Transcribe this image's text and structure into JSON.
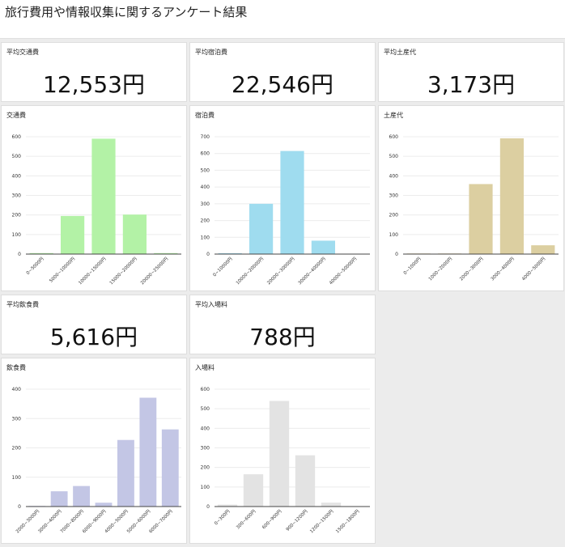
{
  "header": {
    "title": "旅行費用や情報収集に関するアンケート結果"
  },
  "kpis": {
    "transport": {
      "label": "平均交通費",
      "value": "12,553円"
    },
    "lodging": {
      "label": "平均宿泊費",
      "value": "22,546円"
    },
    "souvenir": {
      "label": "平均土産代",
      "value": "3,173円"
    },
    "food": {
      "label": "平均飲食費",
      "value": "5,616円"
    },
    "admission": {
      "label": "平均入場料",
      "value": "788円"
    }
  },
  "chart_data": [
    {
      "id": "transport",
      "type": "bar",
      "title": "交通費",
      "categories": [
        "0~5000円",
        "5000~10000円",
        "10000~15000円",
        "15000~20000円",
        "20000~25000円"
      ],
      "values": [
        5,
        195,
        590,
        202,
        5
      ],
      "ylim": [
        0,
        600
      ],
      "yticks": [
        0,
        100,
        200,
        300,
        400,
        500,
        600
      ],
      "color": "#b3f2a6",
      "grid": true
    },
    {
      "id": "lodging",
      "type": "bar",
      "title": "宿泊費",
      "categories": [
        "0~10000円",
        "10000~20000円",
        "20000~30000円",
        "30000~40000円",
        "40000~50000円"
      ],
      "values": [
        5,
        300,
        615,
        80,
        2
      ],
      "ylim": [
        0,
        700
      ],
      "yticks": [
        0,
        100,
        200,
        300,
        400,
        500,
        600,
        700
      ],
      "color": "#9fdcef",
      "grid": true
    },
    {
      "id": "souvenir",
      "type": "bar",
      "title": "土産代",
      "categories": [
        "0~1000円",
        "1000~2000円",
        "2000~3000円",
        "3000~4000円",
        "4000~5000円"
      ],
      "values": [
        3,
        3,
        358,
        592,
        45
      ],
      "ylim": [
        0,
        600
      ],
      "yticks": [
        0,
        100,
        200,
        300,
        400,
        500,
        600
      ],
      "color": "#dccfa1",
      "grid": true
    },
    {
      "id": "food",
      "type": "bar",
      "title": "飲食費",
      "categories": [
        "2000~3000円",
        "3000~4000円",
        "7000~8000円",
        "6000~9000円",
        "4000~5000円",
        "5000~6000円",
        "6000~7000円"
      ],
      "values": [
        2,
        52,
        70,
        13,
        227,
        371,
        263
      ],
      "ylim": [
        0,
        400
      ],
      "yticks": [
        0,
        100,
        200,
        300,
        400
      ],
      "color": "#c3c6e5",
      "grid": true
    },
    {
      "id": "admission",
      "type": "bar",
      "title": "入場料",
      "categories": [
        "0~300円",
        "300~600円",
        "600~900円",
        "900~1200円",
        "1200~1500円",
        "1500~1800円"
      ],
      "values": [
        10,
        165,
        540,
        262,
        20,
        0
      ],
      "ylim": [
        0,
        600
      ],
      "yticks": [
        0,
        100,
        200,
        300,
        400,
        500,
        600
      ],
      "color": "#e3e3e3",
      "grid": true
    }
  ]
}
